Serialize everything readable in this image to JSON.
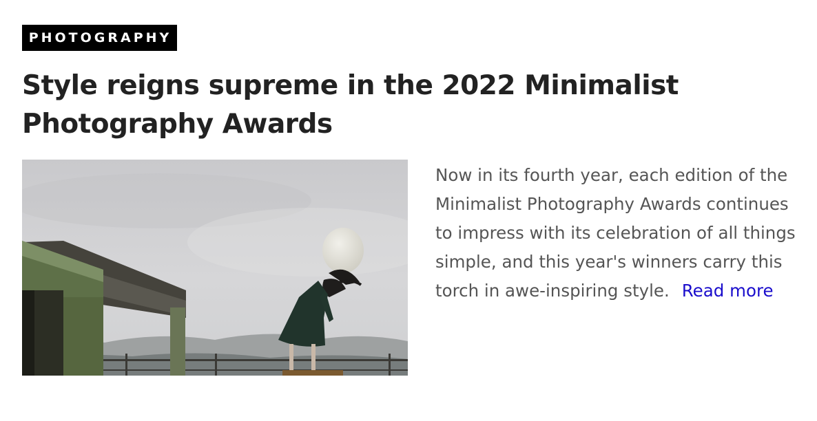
{
  "article": {
    "category": "PHOTOGRAPHY",
    "title": "Style reigns supreme in the 2022 Minimalist Photography Awards",
    "excerpt": "Now in its fourth year, each edition of the Minimalist Photography Awards continues to impress with its celebration of all things simple, and this year's winners carry this torch in awe-inspiring style.",
    "read_more_label": "Read more",
    "image_icon": "article-photo"
  },
  "colors": {
    "badge_background": "#000000",
    "badge_text": "#ffffff",
    "headline": "#222222",
    "body_text": "#555555",
    "link": "#1a0dcc"
  }
}
